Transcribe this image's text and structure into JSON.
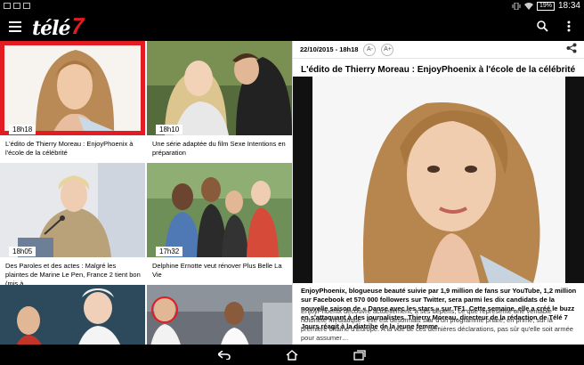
{
  "status_bar": {
    "battery": "19",
    "time": "18:34"
  },
  "app": {
    "logo_text": "télé",
    "logo_number": "7"
  },
  "tiles": [
    {
      "time": "18h18",
      "caption": "L'édito de Thierry Moreau : EnjoyPhoenix à l'école de la célébrité",
      "selected": true
    },
    {
      "time": "18h10",
      "caption": "Une série adaptée du film Sexe Intentions en préparation"
    },
    {
      "time": "18h05",
      "caption": "Des Paroles et des actes : Malgré les plaintes de Marine Le Pen, France 2 tient bon (mis à…"
    },
    {
      "time": "17h32",
      "caption": "Delphine Ernotte veut rénover Plus Belle La Vie"
    }
  ],
  "article": {
    "date": "22/10/2015 - 18h18",
    "font_smaller": "A-",
    "font_larger": "A+",
    "title": "L'édito de Thierry Moreau : EnjoyPhoenix à l'école de la célébrité",
    "lead": "EnjoyPhoenix, blogueuse beauté suivie par 1,9 million de fans sur YouTube, 1,2 million sur Facebook et 570 000 followers sur Twitter, sera parmi les dix candidats de la nouvelle saison de « Danse avec les stars » sur TF1. Cette semaine, elle a créé le buzz en s'attaquant à des journalistes. Thierry Moreau, directeur de la rédaction de Télé 7 Jours réagit à la diatribe de la jeune femme.",
    "body": "EnjoyPhoenix découvre actuellement, à ses dépens, ce que représente une véritable notoriété médiatique : elle est désormais star d'un programme phare, en prime, sur la première chaîne d'Europe. A la vue de ces dernières déclarations, pas sûr qu'elle soit armée pour assumer…"
  },
  "colors": {
    "brand_red": "#e31b23",
    "bar": "#000000"
  },
  "icons": {
    "menu": "menu-icon",
    "search": "search-icon",
    "overflow": "more-vert-icon",
    "share": "share-icon",
    "back": "back-icon",
    "home": "home-icon",
    "recents": "recents-icon"
  }
}
